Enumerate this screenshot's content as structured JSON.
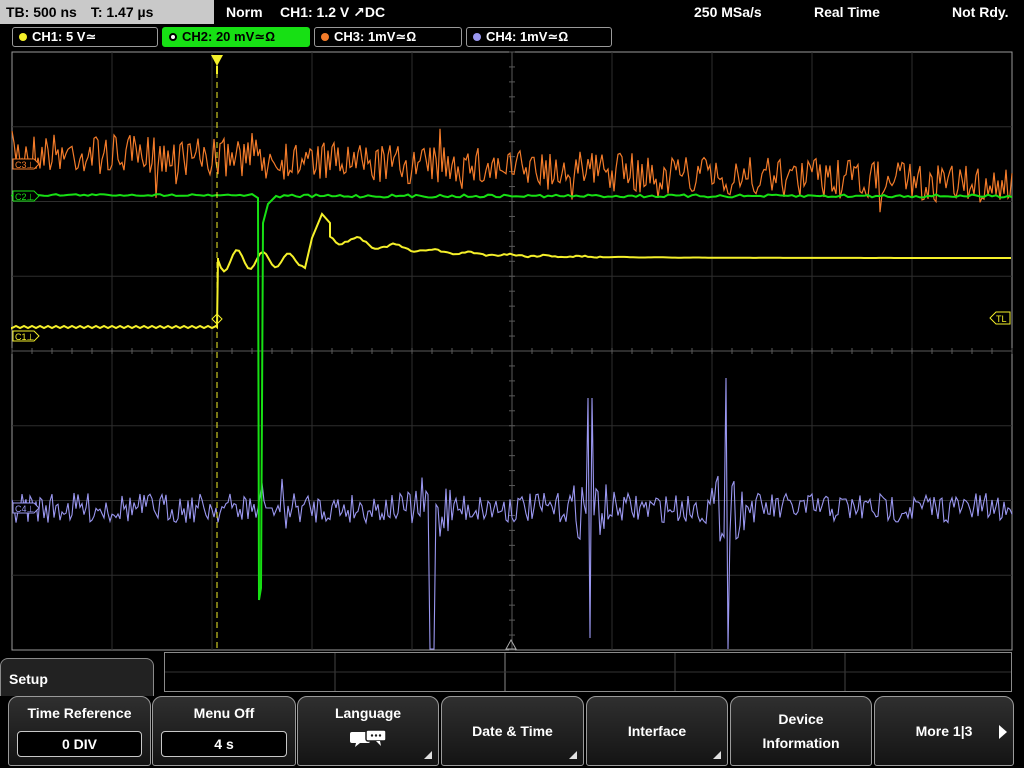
{
  "status": {
    "timebase": "TB: 500 ns",
    "trigger_time": "T: 1.47 µs",
    "mode": "Norm",
    "trigger_source": "CH1: 1.2 V",
    "trigger_slope": "↗",
    "coupling": "DC",
    "sample_rate": "250 MSa/s",
    "acquisition": "Real Time",
    "ready_state": "Not Rdy."
  },
  "channels": [
    {
      "label": "CH1: 5 V≃",
      "color": "#f5f02a",
      "active": false
    },
    {
      "label": "CH2: 20 mV≃Ω",
      "color": "#17e014",
      "active": true
    },
    {
      "label": "CH3: 1mV≃Ω",
      "color": "#f47c2a",
      "active": false
    },
    {
      "label": "CH4: 1mV≃Ω",
      "color": "#9a97f0",
      "active": false
    }
  ],
  "markers": {
    "c1": "C1⊥",
    "c2": "C2⊥",
    "c3": "C3⊥",
    "c4": "C4⊥",
    "trigger_level": "TL"
  },
  "menu": {
    "title": "Setup",
    "time_reference": {
      "label": "Time Reference",
      "value": "0 DIV"
    },
    "menu_off": {
      "label": "Menu Off",
      "value": "4 s"
    },
    "language": {
      "label": "Language"
    },
    "date_time": {
      "label": "Date & Time"
    },
    "interface": {
      "label": "Interface"
    },
    "device_info": {
      "line1": "Device",
      "line2": "Information"
    },
    "more": {
      "label": "More 1|3"
    }
  },
  "icons": {
    "language": "speech-bubbles-icon",
    "trigger": "trigger-position-icon",
    "more": "chevron-right-icon"
  }
}
